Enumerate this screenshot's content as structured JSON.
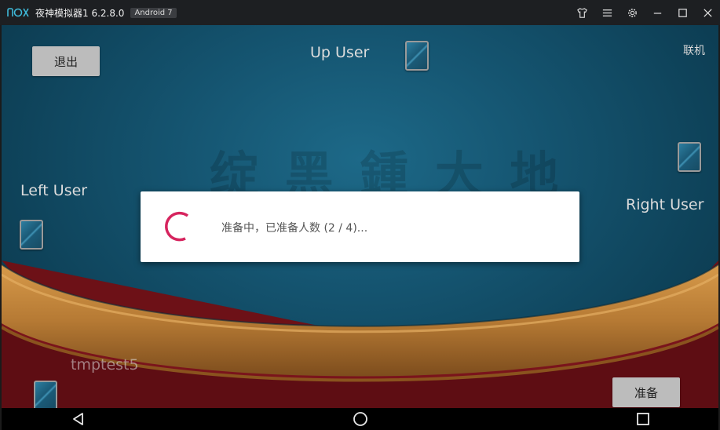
{
  "window": {
    "title": "夜神模拟器1 6.2.8.0",
    "android_badge": "Android 7",
    "icons": [
      "shirt-icon",
      "menu-icon",
      "gear-icon",
      "minimize-icon",
      "maximize-icon",
      "close-icon"
    ]
  },
  "game": {
    "exit_label": "退出",
    "online_label": "联机",
    "ready_label": "准备",
    "players": {
      "up": "Up User",
      "left": "Left User",
      "right": "Right User",
      "self": "tmptest5"
    }
  },
  "dialog": {
    "message": "准备中，已准备人数 (2 / 4)..."
  },
  "colors": {
    "felt": "#155571",
    "table_rim": "#b67a34",
    "spinner": "#d6245e",
    "button": "#bcbcbc"
  }
}
